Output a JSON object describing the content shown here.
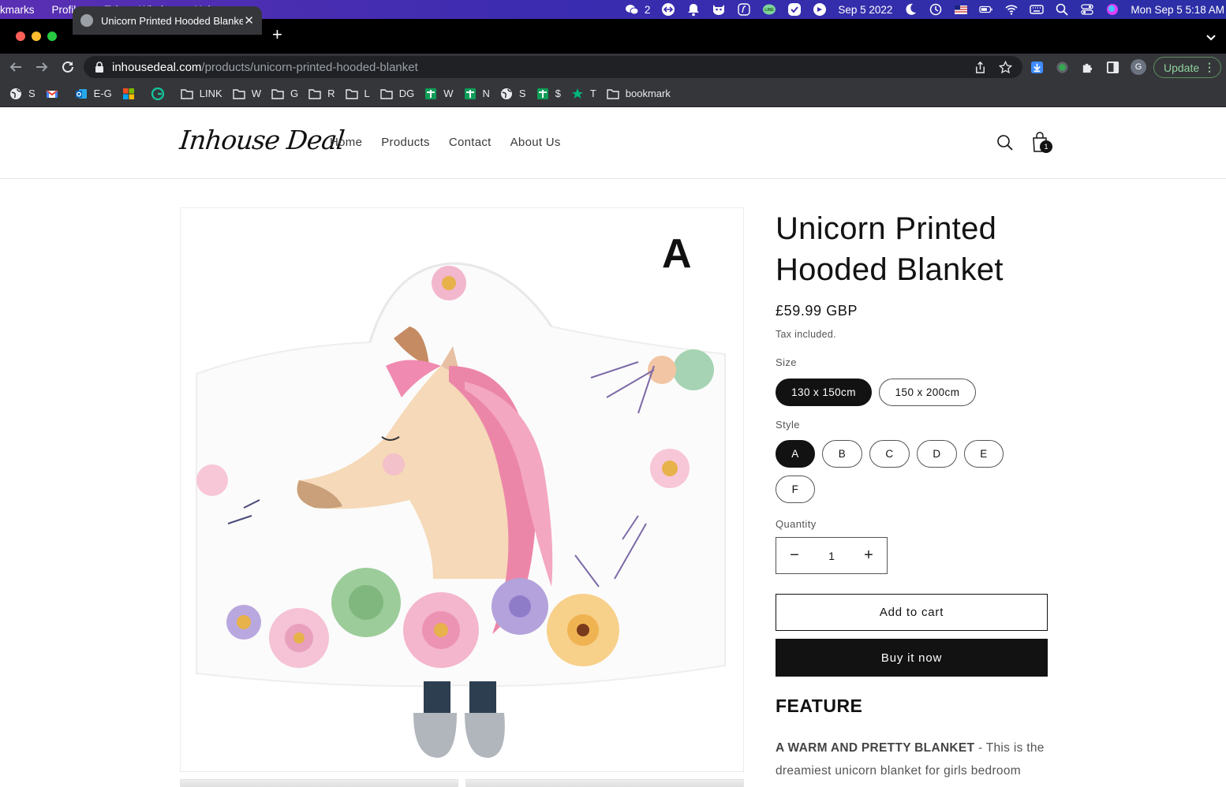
{
  "menubar": {
    "items": [
      "kmarks",
      "Profiles",
      "Tab",
      "Window",
      "Help"
    ],
    "wechat_count": "2",
    "date_short": "Sep 5 2022",
    "clock": "Mon Sep 5  5:18 AM"
  },
  "browser": {
    "tab_title": "Unicorn Printed Hooded Blanket",
    "url_host": "inhousedeal.com",
    "url_path": "/products/unicorn-printed-hooded-blanket",
    "update_label": "Update",
    "profile_initial": "G"
  },
  "bookmarks": [
    {
      "label": "S",
      "icon": "globe-icon"
    },
    {
      "label": "",
      "icon": "gmail-icon"
    },
    {
      "label": "E-G",
      "icon": "outlook-icon"
    },
    {
      "label": "",
      "icon": "microsoft-icon"
    },
    {
      "label": "",
      "icon": "grammarly-icon"
    },
    {
      "label": "LINK",
      "icon": "folder-icon"
    },
    {
      "label": "W",
      "icon": "folder-icon"
    },
    {
      "label": "G",
      "icon": "folder-icon"
    },
    {
      "label": "R",
      "icon": "folder-icon"
    },
    {
      "label": "L",
      "icon": "folder-icon"
    },
    {
      "label": "DG",
      "icon": "folder-icon"
    },
    {
      "label": "W",
      "icon": "sheet-icon"
    },
    {
      "label": "N",
      "icon": "sheet-icon"
    },
    {
      "label": "S",
      "icon": "globe-icon"
    },
    {
      "label": "$",
      "icon": "sheet-icon"
    },
    {
      "label": "T",
      "icon": "star-icon"
    },
    {
      "label": "bookmark",
      "icon": "folder-icon"
    }
  ],
  "store": {
    "logo": "Inhouse Deal",
    "nav": [
      "Home",
      "Products",
      "Contact",
      "About Us"
    ],
    "cart_count": "1"
  },
  "product": {
    "media_letter": "A",
    "title": "Unicorn Printed Hooded Blanket",
    "price": "£59.99 GBP",
    "tax_note": "Tax included.",
    "size_label": "Size",
    "sizes": [
      "130 x 150cm",
      "150 x 200cm"
    ],
    "selected_size": "130 x 150cm",
    "style_label": "Style",
    "styles": [
      "A",
      "B",
      "C",
      "D",
      "E",
      "F"
    ],
    "selected_style": "A",
    "quantity_label": "Quantity",
    "quantity": "1",
    "add_to_cart": "Add to cart",
    "buy_now": "Buy it now",
    "feature_heading": "FEATURE",
    "feature_lead": "A WARM AND PRETTY BLANKET",
    "feature_text": " - This is the dreamiest unicorn blanket for girls bedroom"
  },
  "colors": {
    "menubar": "#3b2cb0",
    "chrome_dark": "#35363a",
    "accent_black": "#121212",
    "update_green": "#8fd19e"
  }
}
